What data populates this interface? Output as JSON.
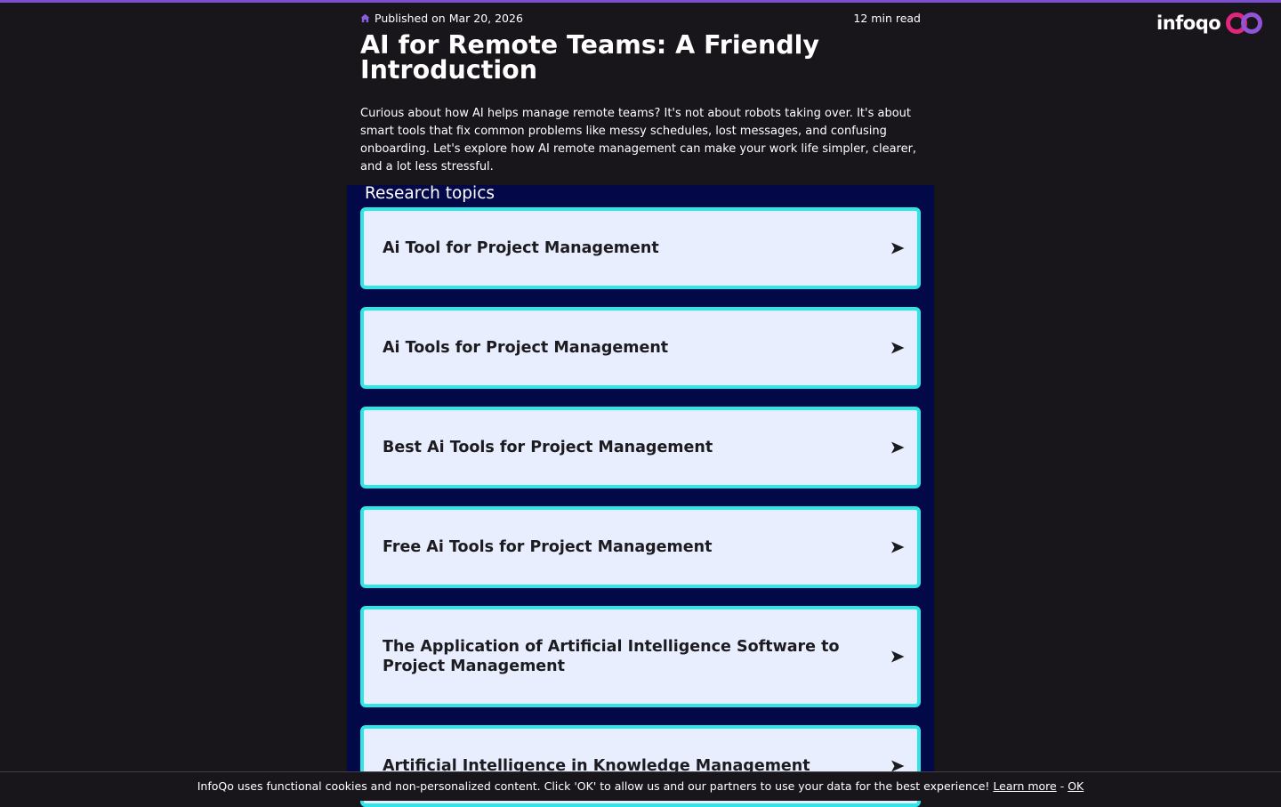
{
  "header": {
    "logo_text": "infoqo",
    "accent_color": "#7b4fd0"
  },
  "article": {
    "published": "Published on Mar 20, 2026",
    "read_time": "12 min read",
    "title": "AI for Remote Teams: A Friendly Introduction",
    "intro": "Curious about how AI helps manage remote teams? It's not about robots taking over. It's about smart tools that fix common problems like messy schedules, lost messages, and confusing onboarding. Let's explore how AI remote management can make your work life simpler, clearer, and a lot less stressful."
  },
  "research": {
    "heading": "Research topics",
    "topics": [
      {
        "label": "Ai Tool for Project Management"
      },
      {
        "label": "Ai Tools for Project Management"
      },
      {
        "label": "Best Ai Tools for Project Management"
      },
      {
        "label": "Free Ai Tools for Project Management"
      },
      {
        "label": "The Application of Artificial Intelligence Software to Project Management"
      },
      {
        "label": "Artificial Intelligence in Knowledge Management"
      }
    ]
  },
  "cookie_bar": {
    "message": "InfoQo uses functional cookies and non-personalized content. Click 'OK' to allow us and our partners to use your data for the best experience!",
    "learn_more": "Learn more",
    "separator": "-",
    "ok": "OK"
  }
}
